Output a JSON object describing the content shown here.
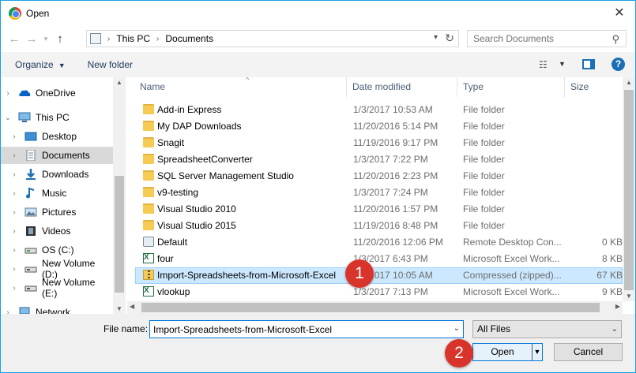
{
  "title": "Open",
  "navigation": {
    "address_segments": [
      "This PC",
      "Documents"
    ],
    "search_placeholder": "Search Documents"
  },
  "toolbar": {
    "organize": "Organize",
    "new_folder": "New folder",
    "help": "?"
  },
  "nav_pane": {
    "items": [
      {
        "label": "OneDrive",
        "icon": "onedrive-icon"
      },
      {
        "label": "This PC",
        "icon": "this-pc-icon"
      },
      {
        "label": "Desktop",
        "icon": "desktop-icon"
      },
      {
        "label": "Documents",
        "icon": "documents-icon",
        "selected": true
      },
      {
        "label": "Downloads",
        "icon": "downloads-icon"
      },
      {
        "label": "Music",
        "icon": "music-icon"
      },
      {
        "label": "Pictures",
        "icon": "pictures-icon"
      },
      {
        "label": "Videos",
        "icon": "videos-icon"
      },
      {
        "label": "OS (C:)",
        "icon": "drive-icon"
      },
      {
        "label": "New Volume (D:)",
        "icon": "drive-icon"
      },
      {
        "label": "New Volume (E:)",
        "icon": "drive-icon"
      },
      {
        "label": "Network",
        "icon": "network-icon"
      }
    ]
  },
  "columns": {
    "name": "Name",
    "date": "Date modified",
    "type": "Type",
    "size": "Size"
  },
  "files": [
    {
      "name": "Add-in Express",
      "date": "1/3/2017 10:53 AM",
      "type": "File folder",
      "size": "",
      "icon": "folder-icon"
    },
    {
      "name": "My DAP Downloads",
      "date": "11/20/2016 5:14 PM",
      "type": "File folder",
      "size": "",
      "icon": "folder-icon"
    },
    {
      "name": "Snagit",
      "date": "11/19/2016 9:17 PM",
      "type": "File folder",
      "size": "",
      "icon": "folder-icon"
    },
    {
      "name": "SpreadsheetConverter",
      "date": "1/3/2017 7:22 PM",
      "type": "File folder",
      "size": "",
      "icon": "folder-icon"
    },
    {
      "name": "SQL Server Management Studio",
      "date": "11/20/2016 2:23 PM",
      "type": "File folder",
      "size": "",
      "icon": "folder-icon"
    },
    {
      "name": "v9-testing",
      "date": "1/3/2017 7:24 PM",
      "type": "File folder",
      "size": "",
      "icon": "folder-icon"
    },
    {
      "name": "Visual Studio 2010",
      "date": "11/20/2016 1:57 PM",
      "type": "File folder",
      "size": "",
      "icon": "folder-icon"
    },
    {
      "name": "Visual Studio 2015",
      "date": "11/19/2016 8:48 PM",
      "type": "File folder",
      "size": "",
      "icon": "folder-icon"
    },
    {
      "name": "Default",
      "date": "11/20/2016 12:06 PM",
      "type": "Remote Desktop Con...",
      "size": "0 KB",
      "icon": "rdp-icon"
    },
    {
      "name": "four",
      "date": "1/3/2017 6:43 PM",
      "type": "Microsoft Excel Work...",
      "size": "8 KB",
      "icon": "excel-icon"
    },
    {
      "name": "Import-Spreadsheets-from-Microsoft-Excel",
      "date": "1/3/2017 10:05 AM",
      "type": "Compressed (zipped)...",
      "size": "67 KB",
      "icon": "zip-icon",
      "selected": true
    },
    {
      "name": "vlookup",
      "date": "1/3/2017 7:13 PM",
      "type": "Microsoft Excel Work...",
      "size": "9 KB",
      "icon": "excel-icon"
    }
  ],
  "footer": {
    "file_name_label": "File name:",
    "file_name_value": "Import-Spreadsheets-from-Microsoft-Excel",
    "filter": "All Files",
    "open": "Open",
    "cancel": "Cancel"
  },
  "annotations": [
    "1",
    "2"
  ],
  "colors": {
    "accent": "#0078d7",
    "selection": "#cce8ff",
    "badge": "#d9342b"
  }
}
